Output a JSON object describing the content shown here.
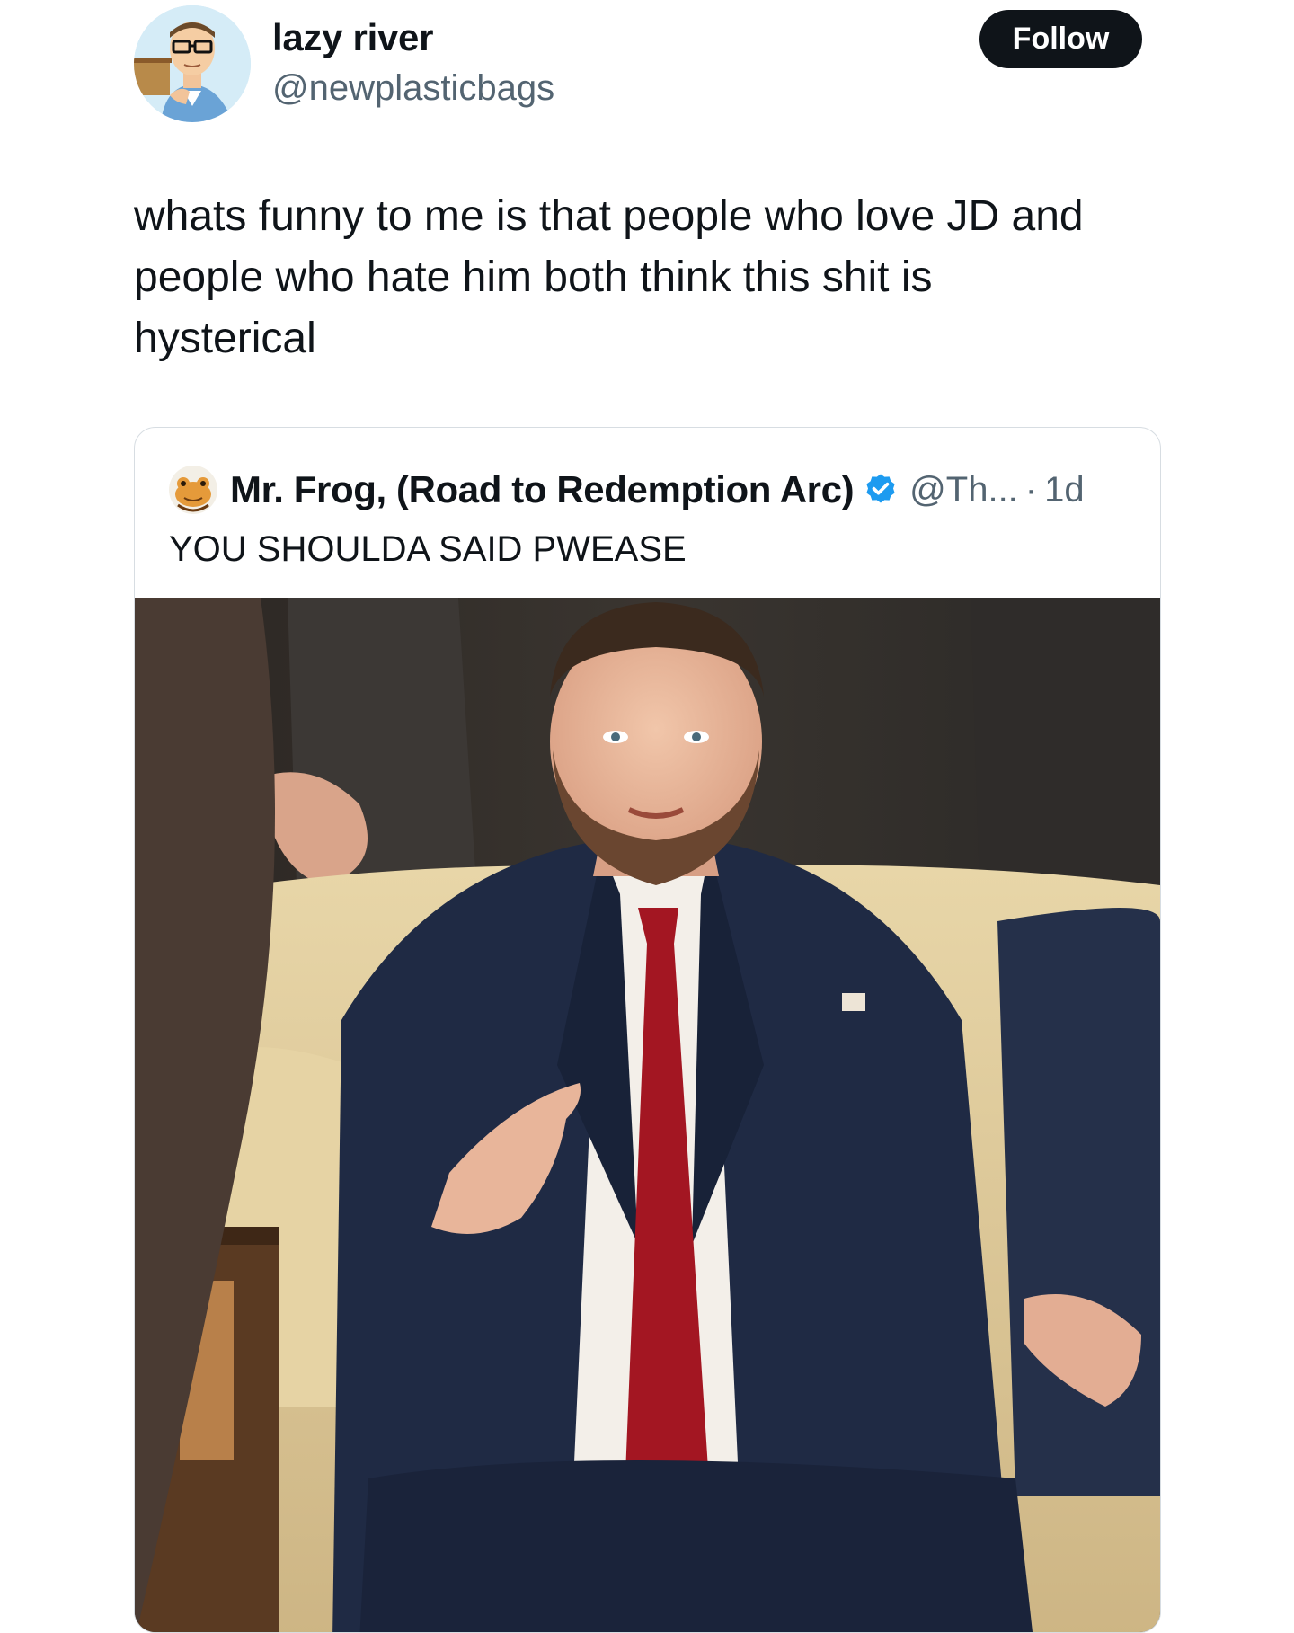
{
  "post": {
    "author": {
      "display_name": "lazy river",
      "handle": "@newplasticbags",
      "avatar_icon": "cartoon-avatar-icon"
    },
    "follow_label": "Follow",
    "text": "whats funny to me is that people who love JD and\npeople who hate him both think this shit is\nhysterical"
  },
  "quote": {
    "author": {
      "display_name": "Mr. Frog, (Road to Redemption Arc)",
      "handle": "@Th...",
      "separator": "·",
      "time": "1d",
      "avatar_icon": "frog-avatar-icon",
      "verified_icon": "verified-badge-icon"
    },
    "text": "YOU SHOULDA SAID PWEASE",
    "media_icon": "photo-image"
  },
  "colors": {
    "text_primary": "#0f1419",
    "text_secondary": "#536471",
    "follow_bg": "#0f1419",
    "verified_blue": "#1d9bf0",
    "card_border": "#d7dde2"
  }
}
